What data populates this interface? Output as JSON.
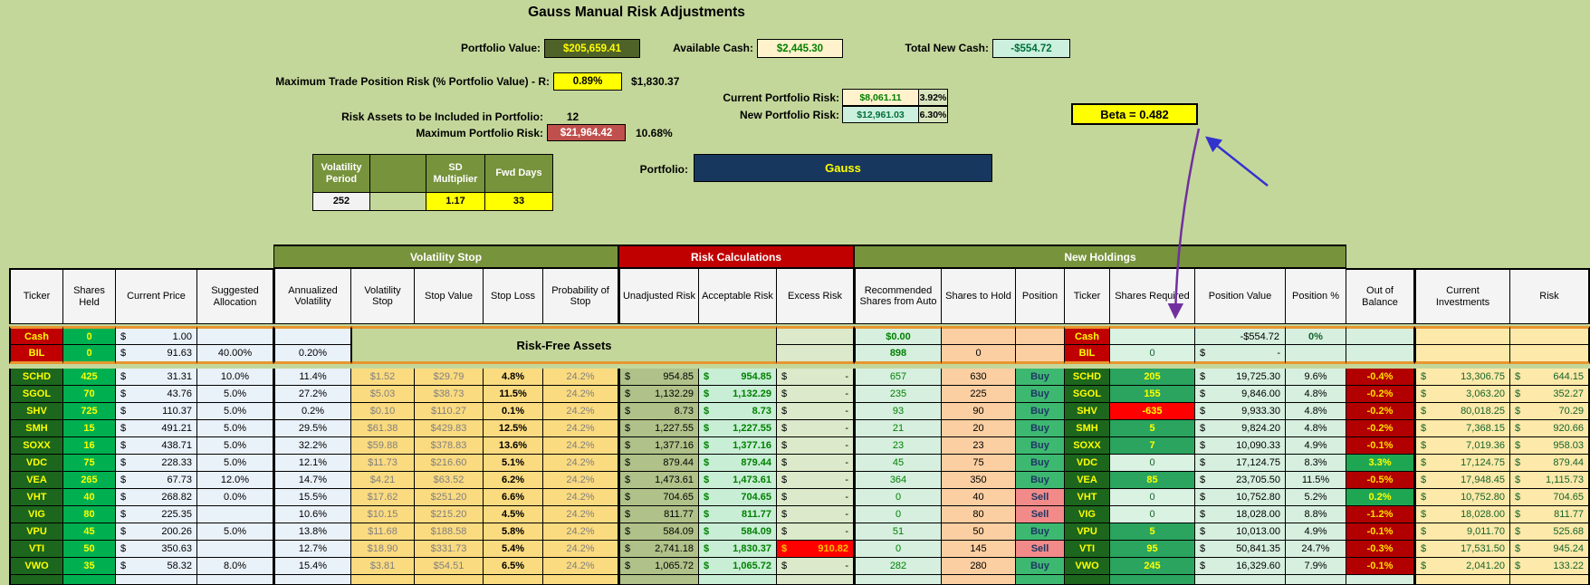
{
  "header": {
    "title": "Gauss Manual Risk Adjustments"
  },
  "summary": {
    "portfolio_value": {
      "label": "Portfolio Value:",
      "value": "$205,659.41"
    },
    "available_cash": {
      "label": "Available Cash:",
      "value": "$2,445.30"
    },
    "total_new_cash": {
      "label": "Total New Cash:",
      "value": "-$554.72"
    },
    "max_trade_risk": {
      "label": "Maximum Trade Position Risk (% Portfolio Value) - R:",
      "value": "0.89%",
      "amount": "$1,830.37"
    },
    "current_risk": {
      "label": "Current Portfolio Risk:",
      "value": "$8,061.11",
      "pct": "3.92%"
    },
    "new_risk": {
      "label": "New Portfolio Risk:",
      "value": "$12,961.03",
      "pct": "6.30%"
    },
    "risk_assets": {
      "label": "Risk Assets to be Included in Portfolio:",
      "value": "12"
    },
    "max_portfolio_risk": {
      "label": "Maximum Portfolio Risk:",
      "value": "$21,964.42",
      "pct": "10.68%"
    },
    "beta": {
      "value": "Beta = 0.482"
    },
    "portfolio": {
      "label": "Portfolio:",
      "value": "Gauss"
    }
  },
  "params": {
    "headers": [
      "Volatility Period",
      "",
      "SD Multiplier",
      "Fwd Days"
    ],
    "values": [
      "252",
      "",
      "1.17",
      "33"
    ]
  },
  "table": {
    "groups": {
      "volatility_stop": "Volatility Stop",
      "risk_calculations": "Risk Calculations",
      "new_holdings": "New Holdings"
    },
    "columns": [
      "Ticker",
      "Shares Held",
      "Current Price",
      "Suggested Allocation",
      "Annualized Volatility",
      "Volatility Stop",
      "Stop Value",
      "Stop Loss",
      "Probability of Stop",
      "Unadjusted Risk",
      "Acceptable Risk",
      "Excess Risk",
      "Recommended Shares from Auto",
      "Shares to Hold",
      "Position",
      "Ticker",
      "Shares Required",
      "Position Value",
      "Position %",
      "Out of Balance",
      "Current Investments",
      "Risk"
    ],
    "risk_free_label": "Risk-Free Assets",
    "risk_free_rows": [
      {
        "t": "Cash",
        "sh": "0",
        "pr": "1.00",
        "al": "",
        "av": "",
        "er": "",
        "rec": "$0.00",
        "hold": "",
        "pos": "",
        "t2": "Cash",
        "req": "",
        "pv": "-$554.72",
        "pp": "0%",
        "ob": "",
        "ci": "",
        "rk": ""
      },
      {
        "t": "BIL",
        "sh": "0",
        "pr": "91.63",
        "al": "40.00%",
        "av": "0.20%",
        "er": "",
        "rec": "898",
        "hold": "0",
        "pos": "",
        "t2": "BIL",
        "req": "0",
        "pv": "-",
        "pp": "",
        "ob": "",
        "ci": "",
        "rk": ""
      }
    ],
    "rows": [
      {
        "t": "SCHD",
        "sh": "425",
        "pr": "31.31",
        "al": "10.0%",
        "av": "11.4%",
        "vs": "$1.52",
        "sv": "$29.79",
        "sl": "4.8%",
        "pb": "24.2%",
        "ur": "954.85",
        "ar": "954.85",
        "er": "-",
        "er_neg": false,
        "rec": "657",
        "hold": "630",
        "pos": "Buy",
        "t2": "SCHD",
        "req": "205",
        "req_s": "pos",
        "pv": "19,725.30",
        "pp": "9.6%",
        "ob": "-0.4%",
        "ob_s": "neg",
        "ci": "13,306.75",
        "rk": "644.15"
      },
      {
        "t": "SGOL",
        "sh": "70",
        "pr": "43.76",
        "al": "5.0%",
        "av": "27.2%",
        "vs": "$5.03",
        "sv": "$38.73",
        "sl": "11.5%",
        "pb": "24.2%",
        "ur": "1,132.29",
        "ar": "1,132.29",
        "er": "-",
        "er_neg": false,
        "rec": "235",
        "hold": "225",
        "pos": "Buy",
        "t2": "SGOL",
        "req": "155",
        "req_s": "pos",
        "pv": "9,846.00",
        "pp": "4.8%",
        "ob": "-0.2%",
        "ob_s": "neg",
        "ci": "3,063.20",
        "rk": "352.27"
      },
      {
        "t": "SHV",
        "sh": "725",
        "pr": "110.37",
        "al": "5.0%",
        "av": "0.2%",
        "vs": "$0.10",
        "sv": "$110.27",
        "sl": "0.1%",
        "pb": "24.2%",
        "ur": "8.73",
        "ar": "8.73",
        "er": "-",
        "er_neg": false,
        "rec": "93",
        "hold": "90",
        "pos": "Buy",
        "t2": "SHV",
        "req": "-635",
        "req_s": "neg",
        "pv": "9,933.30",
        "pp": "4.8%",
        "ob": "-0.2%",
        "ob_s": "neg",
        "ci": "80,018.25",
        "rk": "70.29"
      },
      {
        "t": "SMH",
        "sh": "15",
        "pr": "491.21",
        "al": "5.0%",
        "av": "29.5%",
        "vs": "$61.38",
        "sv": "$429.83",
        "sl": "12.5%",
        "pb": "24.2%",
        "ur": "1,227.55",
        "ar": "1,227.55",
        "er": "-",
        "er_neg": false,
        "rec": "21",
        "hold": "20",
        "pos": "Buy",
        "t2": "SMH",
        "req": "5",
        "req_s": "pos",
        "pv": "9,824.20",
        "pp": "4.8%",
        "ob": "-0.2%",
        "ob_s": "neg",
        "ci": "7,368.15",
        "rk": "920.66"
      },
      {
        "t": "SOXX",
        "sh": "16",
        "pr": "438.71",
        "al": "5.0%",
        "av": "32.2%",
        "vs": "$59.88",
        "sv": "$378.83",
        "sl": "13.6%",
        "pb": "24.2%",
        "ur": "1,377.16",
        "ar": "1,377.16",
        "er": "-",
        "er_neg": false,
        "rec": "23",
        "hold": "23",
        "pos": "Buy",
        "t2": "SOXX",
        "req": "7",
        "req_s": "pos",
        "pv": "10,090.33",
        "pp": "4.9%",
        "ob": "-0.1%",
        "ob_s": "neg",
        "ci": "7,019.36",
        "rk": "958.03"
      },
      {
        "t": "VDC",
        "sh": "75",
        "pr": "228.33",
        "al": "5.0%",
        "av": "12.1%",
        "vs": "$11.73",
        "sv": "$216.60",
        "sl": "5.1%",
        "pb": "24.2%",
        "ur": "879.44",
        "ar": "879.44",
        "er": "-",
        "er_neg": false,
        "rec": "45",
        "hold": "75",
        "pos": "Buy",
        "t2": "VDC",
        "req": "0",
        "req_s": "zero",
        "pv": "17,124.75",
        "pp": "8.3%",
        "ob": "3.3%",
        "ob_s": "pos",
        "ci": "17,124.75",
        "rk": "879.44"
      },
      {
        "t": "VEA",
        "sh": "265",
        "pr": "67.73",
        "al": "12.0%",
        "av": "14.7%",
        "vs": "$4.21",
        "sv": "$63.52",
        "sl": "6.2%",
        "pb": "24.2%",
        "ur": "1,473.61",
        "ar": "1,473.61",
        "er": "-",
        "er_neg": false,
        "rec": "364",
        "hold": "350",
        "pos": "Buy",
        "t2": "VEA",
        "req": "85",
        "req_s": "pos",
        "pv": "23,705.50",
        "pp": "11.5%",
        "ob": "-0.5%",
        "ob_s": "neg",
        "ci": "17,948.45",
        "rk": "1,115.73"
      },
      {
        "t": "VHT",
        "sh": "40",
        "pr": "268.82",
        "al": "0.0%",
        "av": "15.5%",
        "vs": "$17.62",
        "sv": "$251.20",
        "sl": "6.6%",
        "pb": "24.2%",
        "ur": "704.65",
        "ar": "704.65",
        "er": "-",
        "er_neg": false,
        "rec": "0",
        "hold": "40",
        "pos": "Sell",
        "t2": "VHT",
        "req": "0",
        "req_s": "zero",
        "pv": "10,752.80",
        "pp": "5.2%",
        "ob": "0.2%",
        "ob_s": "pos",
        "ci": "10,752.80",
        "rk": "704.65"
      },
      {
        "t": "VIG",
        "sh": "80",
        "pr": "225.35",
        "al": "",
        "av": "10.6%",
        "vs": "$10.15",
        "sv": "$215.20",
        "sl": "4.5%",
        "pb": "24.2%",
        "ur": "811.77",
        "ar": "811.77",
        "er": "-",
        "er_neg": false,
        "rec": "0",
        "hold": "80",
        "pos": "Sell",
        "t2": "VIG",
        "req": "0",
        "req_s": "zero",
        "pv": "18,028.00",
        "pp": "8.8%",
        "ob": "-1.2%",
        "ob_s": "neg",
        "ci": "18,028.00",
        "rk": "811.77"
      },
      {
        "t": "VPU",
        "sh": "45",
        "pr": "200.26",
        "al": "5.0%",
        "av": "13.8%",
        "vs": "$11.68",
        "sv": "$188.58",
        "sl": "5.8%",
        "pb": "24.2%",
        "ur": "584.09",
        "ar": "584.09",
        "er": "-",
        "er_neg": false,
        "rec": "51",
        "hold": "50",
        "pos": "Buy",
        "t2": "VPU",
        "req": "5",
        "req_s": "pos",
        "pv": "10,013.00",
        "pp": "4.9%",
        "ob": "-0.1%",
        "ob_s": "neg",
        "ci": "9,011.70",
        "rk": "525.68"
      },
      {
        "t": "VTI",
        "sh": "50",
        "pr": "350.63",
        "al": "",
        "av": "12.7%",
        "vs": "$18.90",
        "sv": "$331.73",
        "sl": "5.4%",
        "pb": "24.2%",
        "ur": "2,741.18",
        "ar": "1,830.37",
        "er": "910.82",
        "er_neg": true,
        "rec": "0",
        "hold": "145",
        "pos": "Sell",
        "t2": "VTI",
        "req": "95",
        "req_s": "pos",
        "pv": "50,841.35",
        "pp": "24.7%",
        "ob": "-0.3%",
        "ob_s": "neg",
        "ci": "17,531.50",
        "rk": "945.24"
      },
      {
        "t": "VWO",
        "sh": "35",
        "pr": "58.32",
        "al": "8.0%",
        "av": "15.4%",
        "vs": "$3.81",
        "sv": "$54.51",
        "sl": "6.5%",
        "pb": "24.2%",
        "ur": "1,065.72",
        "ar": "1,065.72",
        "er": "-",
        "er_neg": false,
        "rec": "282",
        "hold": "280",
        "pos": "Buy",
        "t2": "VWO",
        "req": "245",
        "req_s": "pos",
        "pv": "16,329.60",
        "pp": "7.9%",
        "ob": "-0.1%",
        "ob_s": "neg",
        "ci": "2,041.20",
        "rk": "133.22"
      }
    ]
  }
}
